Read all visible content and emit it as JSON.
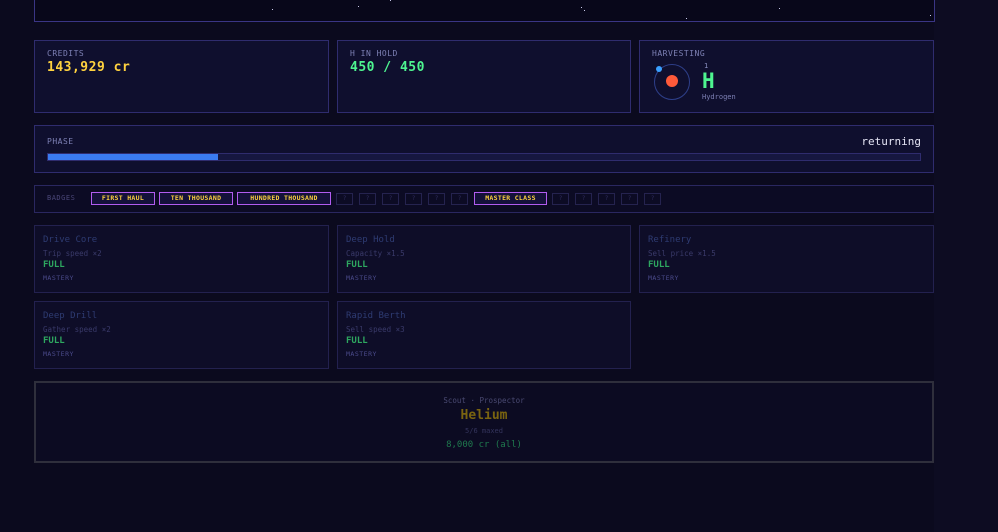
{
  "stats": {
    "credits": {
      "label": "CREDITS",
      "value": "143,929 cr"
    },
    "hold": {
      "label": "H IN HOLD",
      "value": "450 / 450"
    },
    "harvesting": {
      "label": "HARVESTING",
      "element_number": "1",
      "element_symbol": "H",
      "element_name": "Hydrogen"
    }
  },
  "phase": {
    "label": "PHASE",
    "status": "returning",
    "progress": 0.195
  },
  "badges": {
    "label": "BADGES",
    "items": [
      {
        "label": "FIRST HAUL",
        "unlocked": true
      },
      {
        "label": "TEN THOUSAND",
        "unlocked": true
      },
      {
        "label": "HUNDRED THOUSAND",
        "unlocked": true
      },
      {
        "label": "?",
        "unlocked": false
      },
      {
        "label": "?",
        "unlocked": false
      },
      {
        "label": "?",
        "unlocked": false
      },
      {
        "label": "?",
        "unlocked": false
      },
      {
        "label": "?",
        "unlocked": false
      },
      {
        "label": "?",
        "unlocked": false
      },
      {
        "label": "MASTER CLASS",
        "unlocked": true
      },
      {
        "label": "?",
        "unlocked": false
      },
      {
        "label": "?",
        "unlocked": false
      },
      {
        "label": "?",
        "unlocked": false
      },
      {
        "label": "?",
        "unlocked": false
      },
      {
        "label": "?",
        "unlocked": false
      }
    ]
  },
  "upgrades": [
    {
      "name": "Drive Core",
      "effect": "Trip speed ×2",
      "status": "FULL",
      "tier": "MASTERY"
    },
    {
      "name": "Deep Hold",
      "effect": "Capacity ×1.5",
      "status": "FULL",
      "tier": "MASTERY"
    },
    {
      "name": "Refinery",
      "effect": "Sell price ×1.5",
      "status": "FULL",
      "tier": "MASTERY"
    },
    {
      "name": "Deep Drill",
      "effect": "Gather speed ×2",
      "status": "FULL",
      "tier": "MASTERY"
    },
    {
      "name": "Rapid Berth",
      "effect": "Sell speed ×3",
      "status": "FULL",
      "tier": "MASTERY"
    }
  ],
  "ship": {
    "subtitle": "Scout · Prospector",
    "name": "Helium",
    "maxed": "5/6 maxed",
    "cost": "8,000 cr (all)"
  },
  "colors": {
    "background": "#0b0a1e",
    "credits": "#ffd23f",
    "hold": "#4ef590",
    "progress": "#3a7bf0",
    "badge_border": "#b15cf0"
  }
}
